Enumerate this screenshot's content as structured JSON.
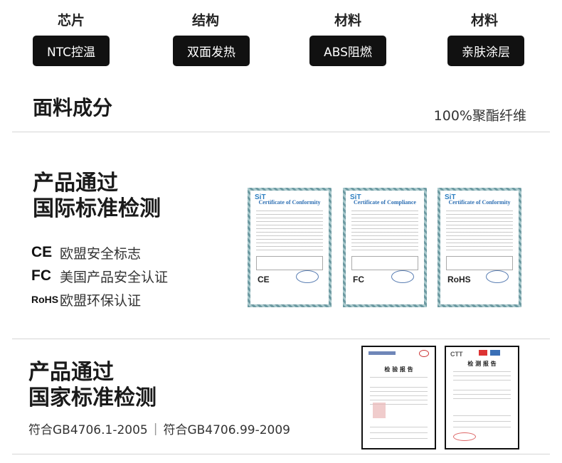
{
  "features": [
    {
      "heading": "芯片",
      "value": "NTC控温"
    },
    {
      "heading": "结构",
      "value": "双面发热"
    },
    {
      "heading": "材料",
      "value": "ABS阻燃"
    },
    {
      "heading": "材料",
      "value": "亲肤涂层"
    }
  ],
  "fabric": {
    "label": "面料成分",
    "value": "100%聚酯纤维"
  },
  "international": {
    "title_line1": "产品通过",
    "title_line2": "国际标准检测",
    "certs": [
      {
        "icon": "CE",
        "label": "欧盟安全标志"
      },
      {
        "icon": "FC",
        "label": "美国产品安全认证"
      },
      {
        "icon": "RoHS",
        "label": "欧盟环保认证"
      }
    ],
    "cert_images": [
      {
        "brand": "SiT",
        "title": "Certificate of Conformity",
        "mark": "CE"
      },
      {
        "brand": "SiT",
        "title": "Certificate of Compliance",
        "mark": "FC"
      },
      {
        "brand": "SiT",
        "title": "Certificate of Conformity",
        "mark": "RoHS"
      }
    ]
  },
  "national": {
    "title_line1": "产品通过",
    "title_line2": "国家标准检测",
    "standard1": "符合GB4706.1-2005",
    "separator": "|",
    "standard2": "符合GB4706.99-2009",
    "reports": [
      {
        "title": "检 验 报 告"
      },
      {
        "title": "检 测 报 告",
        "logo": "CTT"
      }
    ]
  }
}
